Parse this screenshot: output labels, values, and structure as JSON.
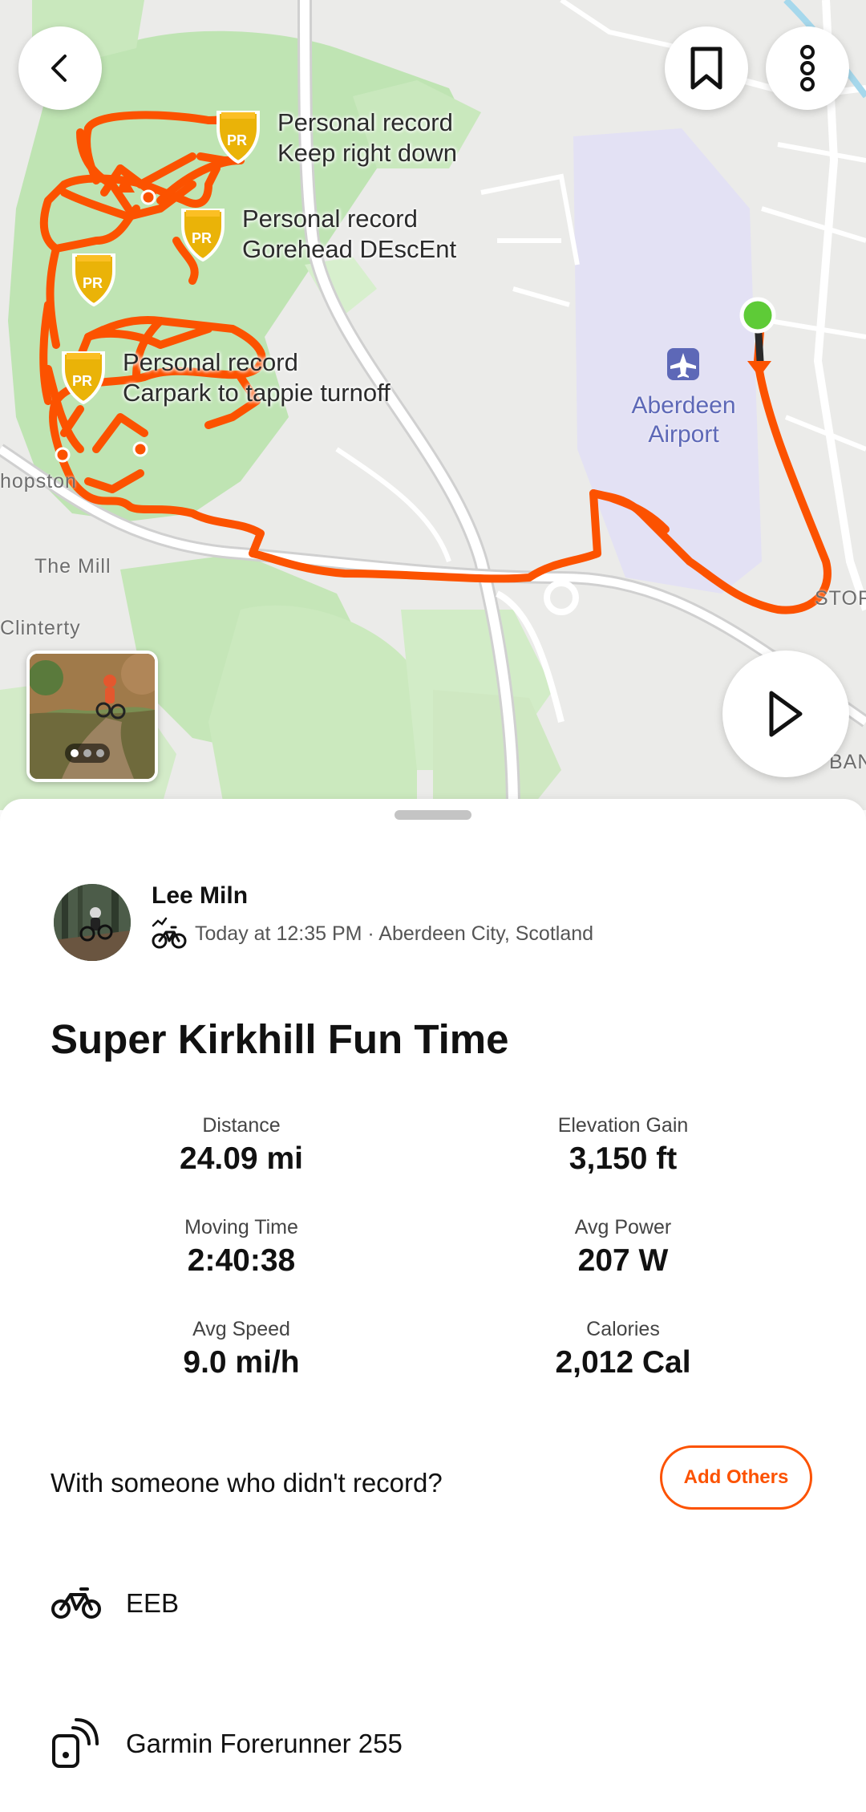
{
  "map": {
    "personal_records": [
      {
        "title": "Personal record",
        "segment": "Keep right down"
      },
      {
        "title": "Personal record",
        "segment": "Gorehead DEscEnt"
      },
      {
        "title": "Personal record",
        "segment": "Carpark to tappie turnoff"
      }
    ],
    "pr_badge_text": "PR",
    "airport_name": "Aberdeen Airport",
    "place_labels": {
      "hopston": "hopston",
      "the_mill": "The Mill",
      "clinterty": "Clinterty",
      "stor": "STOR",
      "ban": "BAN"
    },
    "route_color": "#fc5200",
    "photo_count": 3,
    "photo_selected_index": 0,
    "icons": {
      "back": "chevron-left-icon",
      "bookmark": "bookmark-icon",
      "more": "more-vertical-icon",
      "play": "play-icon",
      "airport": "airplane-icon"
    }
  },
  "activity": {
    "athlete_name": "Lee Miln",
    "meta": "Today at 12:35 PM · Aberdeen City, Scotland",
    "sport_icon": "mountain-bike-icon",
    "title": "Super Kirkhill Fun Time",
    "stats": [
      {
        "label": "Distance",
        "value": "24.09 mi"
      },
      {
        "label": "Elevation Gain",
        "value": "3,150 ft"
      },
      {
        "label": "Moving Time",
        "value": "2:40:38"
      },
      {
        "label": "Avg Power",
        "value": "207 W"
      },
      {
        "label": "Avg Speed",
        "value": "9.0 mi/h"
      },
      {
        "label": "Calories",
        "value": "2,012 Cal"
      }
    ],
    "with_others_prompt": "With someone who didn't record?",
    "add_others_label": "Add Others",
    "gear": {
      "bike": "EEB",
      "device": "Garmin Forerunner 255"
    },
    "accent_color": "#fc5200"
  }
}
